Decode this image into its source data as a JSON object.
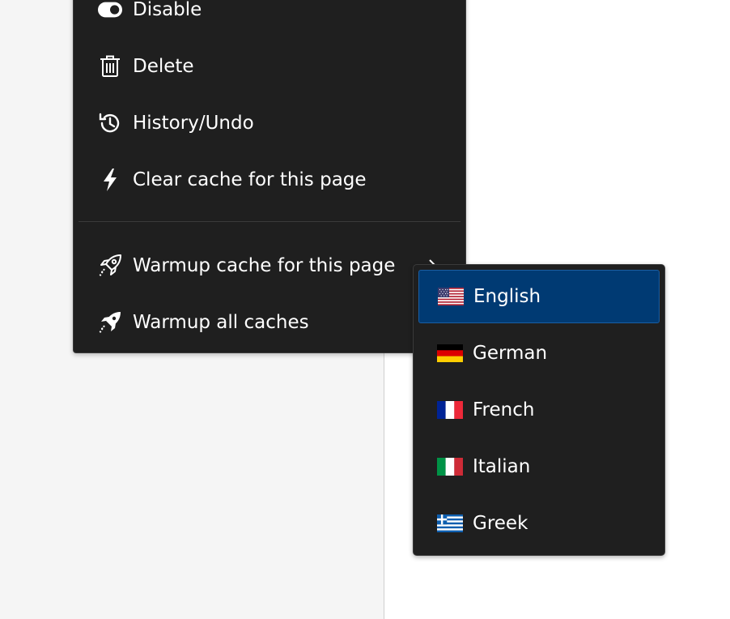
{
  "menu": {
    "items": [
      {
        "label": "Disable",
        "icon": "toggle-icon"
      },
      {
        "label": "Delete",
        "icon": "trash-icon"
      },
      {
        "label": "History/Undo",
        "icon": "history-icon"
      },
      {
        "label": "Clear cache for this page",
        "icon": "lightning-icon"
      },
      {
        "label": "Warmup cache for this page",
        "icon": "rocket-outline-icon",
        "has_submenu": true
      },
      {
        "label": "Warmup all caches",
        "icon": "rocket-icon"
      }
    ]
  },
  "submenu": {
    "items": [
      {
        "label": "English",
        "flag": "us-flag-icon",
        "active": true
      },
      {
        "label": "German",
        "flag": "de-flag-icon"
      },
      {
        "label": "French",
        "flag": "fr-flag-icon"
      },
      {
        "label": "Italian",
        "flag": "it-flag-icon"
      },
      {
        "label": "Greek",
        "flag": "gr-flag-icon"
      }
    ]
  },
  "colors": {
    "menu_bg": "#1f1f1f",
    "active_bg": "#003a73",
    "text": "#ffffff",
    "page_bg": "#f5f5f5"
  }
}
